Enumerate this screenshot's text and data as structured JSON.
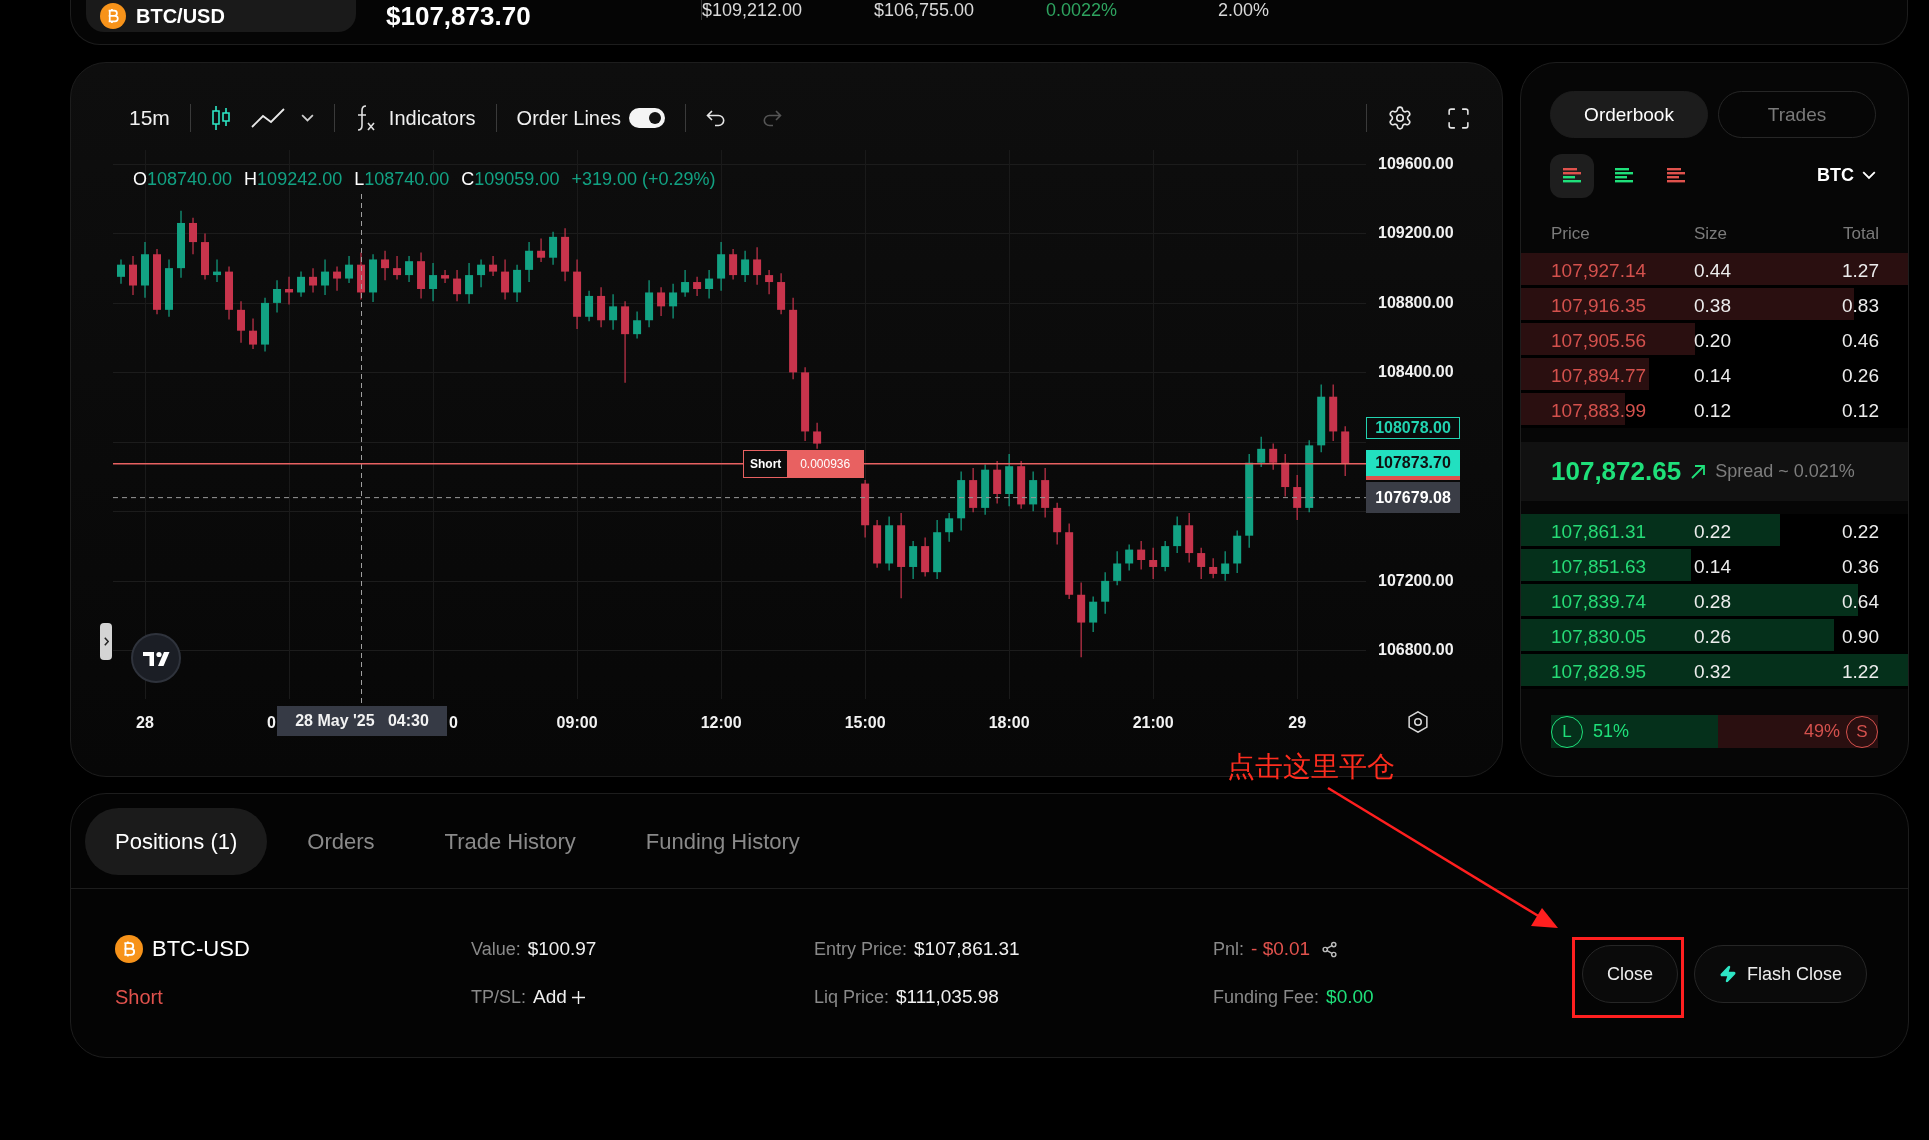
{
  "market": {
    "symbol": "BTC/USD",
    "price": "$107,873.70",
    "stats": [
      {
        "value": "$109,212.00",
        "color": "#d9d9d9"
      },
      {
        "value": "$106,755.00",
        "color": "#d9d9d9"
      },
      {
        "value": "0.0022%",
        "color": "#2ea35f"
      },
      {
        "value": "2.00%",
        "color": "#d9d9d9"
      }
    ]
  },
  "chart": {
    "toolbar": {
      "interval": "15m",
      "chart_types": [
        {
          "kind": "candles",
          "selected": true
        },
        {
          "kind": "line",
          "selected": false
        }
      ],
      "indicators": "Indicators",
      "order_lines": {
        "label": "Order Lines",
        "on": true
      },
      "undo": {
        "disabled": false
      },
      "redo": {
        "disabled": true
      }
    },
    "legend": [
      {
        "key": "O",
        "value": "108740.00"
      },
      {
        "key": "H",
        "value": "109242.00"
      },
      {
        "key": "L",
        "value": "108740.00"
      },
      {
        "key": "C",
        "value": "109059.00"
      }
    ],
    "change": "+319.00 (+0.29%)",
    "chart_data": {
      "type": "candlestick",
      "grid": true,
      "x": [
        "2025-05-27 23:30",
        "2025-05-27 23:45",
        "2025-05-28 00:00",
        "2025-05-28 00:15",
        "2025-05-28 00:30",
        "2025-05-28 00:45",
        "2025-05-28 01:00",
        "2025-05-28 01:15",
        "2025-05-28 01:30",
        "2025-05-28 01:45",
        "2025-05-28 02:00",
        "2025-05-28 02:15",
        "2025-05-28 02:30",
        "2025-05-28 02:45",
        "2025-05-28 03:00",
        "2025-05-28 03:15",
        "2025-05-28 03:30",
        "2025-05-28 03:45",
        "2025-05-28 04:00",
        "2025-05-28 04:15",
        "2025-05-28 04:30",
        "2025-05-28 04:45",
        "2025-05-28 05:00",
        "2025-05-28 05:15",
        "2025-05-28 05:30",
        "2025-05-28 05:45",
        "2025-05-28 06:00",
        "2025-05-28 06:15",
        "2025-05-28 06:30",
        "2025-05-28 06:45",
        "2025-05-28 07:00",
        "2025-05-28 07:15",
        "2025-05-28 07:30",
        "2025-05-28 07:45",
        "2025-05-28 08:00",
        "2025-05-28 08:15",
        "2025-05-28 08:30",
        "2025-05-28 08:45",
        "2025-05-28 09:00",
        "2025-05-28 09:15",
        "2025-05-28 09:30",
        "2025-05-28 09:45",
        "2025-05-28 10:00",
        "2025-05-28 10:15",
        "2025-05-28 10:30",
        "2025-05-28 10:45",
        "2025-05-28 11:00",
        "2025-05-28 11:15",
        "2025-05-28 11:30",
        "2025-05-28 11:45",
        "2025-05-28 12:00",
        "2025-05-28 12:15",
        "2025-05-28 12:30",
        "2025-05-28 12:45",
        "2025-05-28 13:00",
        "2025-05-28 13:15",
        "2025-05-28 13:30",
        "2025-05-28 13:45",
        "2025-05-28 14:00",
        "2025-05-28 15:00",
        "2025-05-28 15:15",
        "2025-05-28 15:30",
        "2025-05-28 15:45",
        "2025-05-28 16:00",
        "2025-05-28 16:15",
        "2025-05-28 16:30",
        "2025-05-28 16:45",
        "2025-05-28 17:00",
        "2025-05-28 17:15",
        "2025-05-28 17:30",
        "2025-05-28 17:45",
        "2025-05-28 18:00",
        "2025-05-28 18:15",
        "2025-05-28 18:30",
        "2025-05-28 18:45",
        "2025-05-28 19:00",
        "2025-05-28 19:15",
        "2025-05-28 19:30",
        "2025-05-28 19:45",
        "2025-05-28 20:00",
        "2025-05-28 20:15",
        "2025-05-28 20:30",
        "2025-05-28 20:45",
        "2025-05-28 21:00",
        "2025-05-28 21:15",
        "2025-05-28 21:30",
        "2025-05-28 21:45",
        "2025-05-28 22:00",
        "2025-05-28 22:15",
        "2025-05-28 22:30",
        "2025-05-28 22:45",
        "2025-05-28 23:00",
        "2025-05-28 23:15",
        "2025-05-28 23:30",
        "2025-05-28 23:45",
        "2025-05-29 00:00",
        "2025-05-29 00:15",
        "2025-05-29 00:30",
        "2025-05-29 00:45",
        "2025-05-29 01:00"
      ],
      "ohlc": [
        [
          108950,
          109050,
          108910,
          109020
        ],
        [
          109020,
          109070,
          108845,
          108900
        ],
        [
          108900,
          109150,
          108830,
          109080
        ],
        [
          109080,
          109110,
          108735,
          108760
        ],
        [
          108760,
          109050,
          108720,
          109000
        ],
        [
          109000,
          109330,
          108945,
          109260
        ],
        [
          109260,
          109290,
          109080,
          109150
        ],
        [
          109150,
          109200,
          108935,
          108960
        ],
        [
          108960,
          109050,
          108920,
          108980
        ],
        [
          108980,
          109010,
          108705,
          108760
        ],
        [
          108760,
          108810,
          108570,
          108640
        ],
        [
          108640,
          108710,
          108535,
          108560
        ],
        [
          108560,
          108830,
          108520,
          108800
        ],
        [
          108800,
          108930,
          108745,
          108880
        ],
        [
          108880,
          108950,
          108790,
          108860
        ],
        [
          108860,
          108980,
          108835,
          108950
        ],
        [
          108950,
          109000,
          108860,
          108900
        ],
        [
          108900,
          109050,
          108845,
          108980
        ],
        [
          108980,
          109010,
          108870,
          108940
        ],
        [
          108940,
          109070,
          108915,
          109020
        ],
        [
          109020,
          109090,
          108820,
          108860
        ],
        [
          108860,
          109080,
          108805,
          109050
        ],
        [
          109050,
          109100,
          108930,
          109000
        ],
        [
          109000,
          109070,
          108935,
          108960
        ],
        [
          108960,
          109070,
          108920,
          109040
        ],
        [
          109040,
          109090,
          108825,
          108880
        ],
        [
          108880,
          109030,
          108810,
          108960
        ],
        [
          108960,
          108990,
          108915,
          108940
        ],
        [
          108940,
          108990,
          108810,
          108850
        ],
        [
          108850,
          109030,
          108795,
          108960
        ],
        [
          108960,
          109050,
          108890,
          109020
        ],
        [
          109020,
          109070,
          108955,
          108980
        ],
        [
          108980,
          109050,
          108820,
          108860
        ],
        [
          108860,
          109020,
          108805,
          108990
        ],
        [
          108990,
          109150,
          108920,
          109100
        ],
        [
          109100,
          109170,
          109035,
          109060
        ],
        [
          109060,
          109210,
          109020,
          109180
        ],
        [
          109180,
          109230,
          108925,
          108980
        ],
        [
          108980,
          109050,
          108650,
          108720
        ],
        [
          108720,
          108870,
          108695,
          108840
        ],
        [
          108840,
          108890,
          108660,
          108700
        ],
        [
          108700,
          108850,
          108645,
          108780
        ],
        [
          108780,
          108810,
          108340,
          108620
        ],
        [
          108620,
          108750,
          108595,
          108700
        ],
        [
          108700,
          108930,
          108660,
          108860
        ],
        [
          108860,
          108890,
          108725,
          108780
        ],
        [
          108780,
          108910,
          108710,
          108860
        ],
        [
          108860,
          108990,
          108835,
          108920
        ],
        [
          108920,
          108950,
          108840,
          108880
        ],
        [
          108880,
          108990,
          108825,
          108940
        ],
        [
          108940,
          109150,
          108870,
          109080
        ],
        [
          109080,
          109110,
          108935,
          108960
        ],
        [
          108960,
          109100,
          108920,
          109050
        ],
        [
          109050,
          109120,
          108905,
          108960
        ],
        [
          108960,
          108990,
          108850,
          108920
        ],
        [
          108920,
          108970,
          108735,
          108760
        ],
        [
          108760,
          108830,
          108360,
          108400
        ],
        [
          108400,
          108430,
          108005,
          108060
        ],
        [
          108060,
          108110,
          107960,
          107990
        ],
        [
          107760,
          107780,
          107450,
          107520
        ],
        [
          107520,
          107550,
          107275,
          107300
        ],
        [
          107300,
          107570,
          107260,
          107520
        ],
        [
          107520,
          107590,
          107100,
          107280
        ],
        [
          107280,
          107430,
          107210,
          107400
        ],
        [
          107400,
          107450,
          107225,
          107250
        ],
        [
          107250,
          107550,
          107210,
          107480
        ],
        [
          107480,
          107590,
          107425,
          107560
        ],
        [
          107560,
          107830,
          107490,
          107780
        ],
        [
          107780,
          107850,
          107595,
          107620
        ],
        [
          107620,
          107870,
          107580,
          107840
        ],
        [
          107840,
          107890,
          107645,
          107700
        ],
        [
          107700,
          107930,
          107630,
          107860
        ],
        [
          107860,
          107890,
          107615,
          107640
        ],
        [
          107640,
          107830,
          107600,
          107780
        ],
        [
          107780,
          107850,
          107565,
          107620
        ],
        [
          107620,
          107650,
          107410,
          107480
        ],
        [
          107480,
          107530,
          107095,
          107120
        ],
        [
          107120,
          107190,
          106760,
          106960
        ],
        [
          106960,
          107110,
          106905,
          107080
        ],
        [
          107080,
          107250,
          107010,
          107200
        ],
        [
          107200,
          107370,
          107175,
          107300
        ],
        [
          107300,
          107410,
          107260,
          107380
        ],
        [
          107380,
          107430,
          107265,
          107320
        ],
        [
          107320,
          107390,
          107210,
          107280
        ],
        [
          107280,
          107430,
          107255,
          107400
        ],
        [
          107400,
          107570,
          107360,
          107520
        ],
        [
          107520,
          107590,
          107305,
          107360
        ],
        [
          107360,
          107390,
          107210,
          107280
        ],
        [
          107280,
          107330,
          107215,
          107240
        ],
        [
          107240,
          107370,
          107200,
          107300
        ],
        [
          107300,
          107490,
          107245,
          107460
        ],
        [
          107460,
          107930,
          107390,
          107880
        ],
        [
          107880,
          108030,
          107855,
          107960
        ],
        [
          107960,
          107990,
          107840,
          107880
        ],
        [
          107880,
          107930,
          107685,
          107740
        ],
        [
          107740,
          107810,
          107550,
          107620
        ],
        [
          107620,
          108010,
          107595,
          107980
        ],
        [
          107980,
          108330,
          107940,
          108260
        ],
        [
          108260,
          108330,
          108005,
          108060
        ],
        [
          108060,
          108090,
          107804,
          107873.7
        ]
      ],
      "xlim": [
        "2025-05-27 23:20",
        "2025-05-29 01:26"
      ],
      "ylim": [
        106520,
        109680
      ],
      "xticks": [
        {
          "value": "2025-05-28 00:00",
          "label": "28"
        },
        {
          "value": "2025-05-28 09:00",
          "label": "09:00"
        },
        {
          "value": "2025-05-28 12:00",
          "label": "12:00"
        },
        {
          "value": "2025-05-28 15:00",
          "label": "15:00"
        },
        {
          "value": "2025-05-28 18:00",
          "label": "18:00"
        },
        {
          "value": "2025-05-28 21:00",
          "label": "21:00"
        },
        {
          "value": "2025-05-29 00:00",
          "label": "29"
        }
      ],
      "yticks": [
        {
          "value": 109600,
          "label": "109600.00"
        },
        {
          "value": 109200,
          "label": "109200.00"
        },
        {
          "value": 108800,
          "label": "108800.00"
        },
        {
          "value": 108400,
          "label": "108400.00"
        },
        {
          "value": 107200,
          "label": "107200.00"
        },
        {
          "value": 106800,
          "label": "106800.00"
        }
      ],
      "ref_lines": [
        {
          "axis": "x",
          "value": "2025-05-28 04:30",
          "color": "#a0a0a0"
        },
        {
          "axis": "y",
          "value": 107873.7,
          "color": "#e86161"
        },
        {
          "axis": "y",
          "value": 107679.08,
          "color": "#9a9a9a"
        }
      ]
    },
    "covered_tick_fragments": [
      "0",
      "0"
    ],
    "price_labels": [
      {
        "kind": "outline",
        "text": "108078.00"
      },
      {
        "kind": "last",
        "text": "107873.70"
      },
      {
        "kind": "muted",
        "text": "107679.08"
      }
    ],
    "order_tag": {
      "side": "Short",
      "size": "0.000936",
      "color": "#e86161"
    },
    "crosshair": {
      "label": "28 May '25   04:30"
    }
  },
  "orderbook": {
    "tabs": [
      {
        "label": "Orderbook",
        "selected": true
      },
      {
        "label": "Trades",
        "selected": false
      }
    ],
    "views": [
      {
        "kind": "both",
        "selected": true
      },
      {
        "kind": "bids",
        "selected": false
      },
      {
        "kind": "asks",
        "selected": false
      }
    ],
    "unit": "BTC",
    "columns": [
      "Price",
      "Size",
      "Total"
    ],
    "asks": [
      {
        "price": "107,927.14",
        "size": "0.44",
        "total": "1.27",
        "level": 1.0
      },
      {
        "price": "107,916.35",
        "size": "0.38",
        "total": "0.83",
        "level": 0.86
      },
      {
        "price": "107,905.56",
        "size": "0.20",
        "total": "0.46",
        "level": 0.45
      },
      {
        "price": "107,894.77",
        "size": "0.14",
        "total": "0.26",
        "level": 0.33
      },
      {
        "price": "107,883.99",
        "size": "0.12",
        "total": "0.12",
        "level": 0.27
      }
    ],
    "mid": {
      "price": "107,872.65",
      "rising": true,
      "spread": "Spread ~ 0.021%"
    },
    "bids": [
      {
        "price": "107,861.31",
        "size": "0.22",
        "total": "0.22",
        "level": 0.67
      },
      {
        "price": "107,851.63",
        "size": "0.14",
        "total": "0.36",
        "level": 0.44
      },
      {
        "price": "107,839.74",
        "size": "0.28",
        "total": "0.64",
        "level": 0.87
      },
      {
        "price": "107,830.05",
        "size": "0.26",
        "total": "0.90",
        "level": 0.81
      },
      {
        "price": "107,828.95",
        "size": "0.32",
        "total": "1.22",
        "level": 1.0
      }
    ],
    "long_short": {
      "long_badge": "L",
      "long": "51%",
      "short": "49%",
      "short_badge": "S",
      "level": 0.51
    }
  },
  "positions": {
    "tabs": [
      {
        "label": "Positions (1)",
        "selected": true
      },
      {
        "label": "Orders",
        "selected": false
      },
      {
        "label": "Trade History",
        "selected": false
      },
      {
        "label": "Funding History",
        "selected": false
      }
    ],
    "rows": [
      {
        "symbol": "BTC-USD",
        "side": {
          "text": "Short",
          "color": "#e0524d"
        },
        "columns": [
          {
            "fields": [
              {
                "label": "Value:",
                "value": "$100.97",
                "kind": "text",
                "color": "#f0f0f0"
              },
              {
                "label": "TP/SL:",
                "value": "Add",
                "kind": "add",
                "color": "#f0f0f0"
              }
            ]
          },
          {
            "fields": [
              {
                "label": "Entry Price:",
                "value": "$107,861.31",
                "kind": "text",
                "color": "#f0f0f0"
              },
              {
                "label": "Liq Price:",
                "value": "$111,035.98",
                "kind": "text",
                "color": "#f0f0f0"
              }
            ]
          },
          {
            "fields": [
              {
                "label": "Pnl:",
                "value": "- $0.01",
                "kind": "share",
                "color": "#e0524d"
              },
              {
                "label": "Funding Fee:",
                "value": "$0.00",
                "kind": "text",
                "color": "#1fe07a"
              }
            ]
          }
        ],
        "actions": [
          {
            "kind": "plain",
            "label": "Close"
          },
          {
            "kind": "flash",
            "label": "Flash Close"
          }
        ]
      }
    ]
  },
  "annotation": {
    "text": "点击这里平仓"
  }
}
